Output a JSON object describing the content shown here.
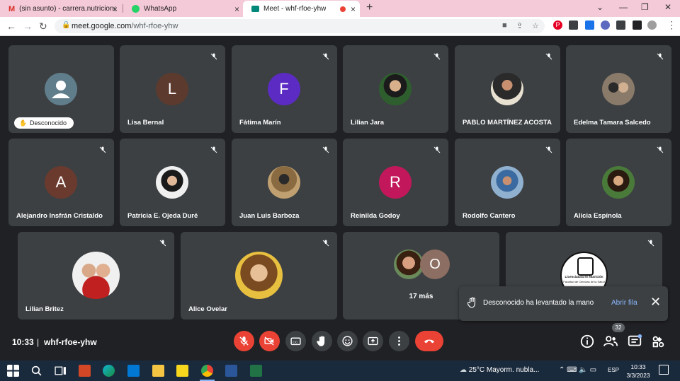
{
  "browser": {
    "tabs": [
      {
        "icon": "gmail-icon",
        "title": "(sin asunto) - carrera.nutricion@",
        "close": "×"
      },
      {
        "icon": "whatsapp-icon",
        "title": "WhatsApp",
        "close": "×"
      },
      {
        "icon": "meet-icon",
        "title": "Meet - whf-rfoe-yhw",
        "close": "×",
        "recording_color": "#ea4335",
        "active": true
      }
    ],
    "new_tab": "+",
    "window_buttons": [
      "⌄",
      "—",
      "❐",
      "✕"
    ],
    "nav": {
      "back": "←",
      "forward": "→",
      "reload": "↻"
    },
    "url_host": "meet.google.com",
    "url_path": "/whf-rfoe-yhw"
  },
  "meeting": {
    "participants": [
      {
        "name": "",
        "avatar_type": "default",
        "chip": "Desconocido"
      },
      {
        "name": "Lisa Bernal",
        "avatar_type": "letter",
        "initial": "L",
        "color": "#5d3a2e",
        "muted": true
      },
      {
        "name": "Fátima Marín",
        "avatar_type": "letter",
        "initial": "F",
        "color": "#5b2bc3",
        "muted": true
      },
      {
        "name": "Lilian Jara",
        "avatar_type": "photo",
        "muted": true
      },
      {
        "name": "PABLO MARTÍNEZ ACOSTA",
        "avatar_type": "photo",
        "muted": true
      },
      {
        "name": "Edelma Tamara Salcedo",
        "avatar_type": "photo",
        "muted": true
      },
      {
        "name": "Alejandro Insfrán Cristaldo",
        "avatar_type": "letter",
        "initial": "A",
        "color": "#6a3a2e",
        "muted": true
      },
      {
        "name": "Patricia E. Ojeda Duré",
        "avatar_type": "photo",
        "muted": true
      },
      {
        "name": "Juan Luis Barboza",
        "avatar_type": "photo",
        "muted": true
      },
      {
        "name": "Reinilda Godoy",
        "avatar_type": "letter",
        "initial": "R",
        "color": "#c2185b",
        "muted": true
      },
      {
        "name": "Rodolfo Cantero",
        "avatar_type": "photo",
        "muted": true
      },
      {
        "name": "Alicia Espínola",
        "avatar_type": "photo",
        "muted": true
      },
      {
        "name": "Lilian Britez",
        "avatar_type": "photo",
        "muted": true
      },
      {
        "name": "Alice Ovelar",
        "avatar_type": "photo",
        "muted": true
      },
      {
        "name": "",
        "avatar_type": "logo",
        "muted": true
      }
    ],
    "more": {
      "label": "17 más",
      "initial": "O",
      "color": "#8d6e63"
    },
    "logo_text": [
      "Licenciatura en Nutrición",
      "Facultad de Ciencias de la Salud"
    ],
    "toast": {
      "message": "Desconocido ha levantado la mano",
      "action": "Abrir fila",
      "close": "✕"
    },
    "time": "10:33",
    "separator": "|",
    "code": "whf-rfoe-yhw",
    "people_count": "32",
    "accent_red": "#ea4335"
  },
  "taskbar": {
    "apps": [
      "windows-start",
      "search",
      "task-view",
      "powerpoint",
      "edge",
      "mail",
      "file-explorer",
      "sticky-notes",
      "chrome",
      "word",
      "excel"
    ],
    "weather": "25°C  Mayorm. nubla...",
    "tray": "⌃ ⌨ 🔈 ▭",
    "lang": "ESP",
    "clock_time": "10:33",
    "clock_date": "3/3/2023"
  }
}
